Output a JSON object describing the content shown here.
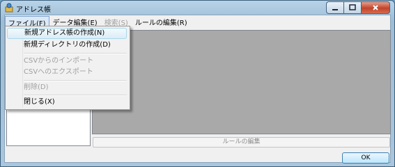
{
  "window": {
    "title": "アドレス帳",
    "controls": [
      "minimize-icon",
      "maximize-icon",
      "close-icon"
    ]
  },
  "menubar": {
    "file": "ファイル(F)",
    "data_edit": "データ編集(E)",
    "search": "検索(S)",
    "rule_edit": "ルールの編集(R)"
  },
  "file_menu": {
    "new_address_book": "新規アドレス帳の作成(N)",
    "new_directory": "新規ディレクトリの作成(D)",
    "csv_import": "CSVからのインポート",
    "csv_export": "CSVへのエクスポート",
    "delete": "削除(D)",
    "close": "閉じる(X)"
  },
  "buttons": {
    "rule_edit": "ルールの編集",
    "ok": "OK"
  },
  "colors": {
    "content_area": "#a9a9a9",
    "highlight": "#dcecf7"
  }
}
